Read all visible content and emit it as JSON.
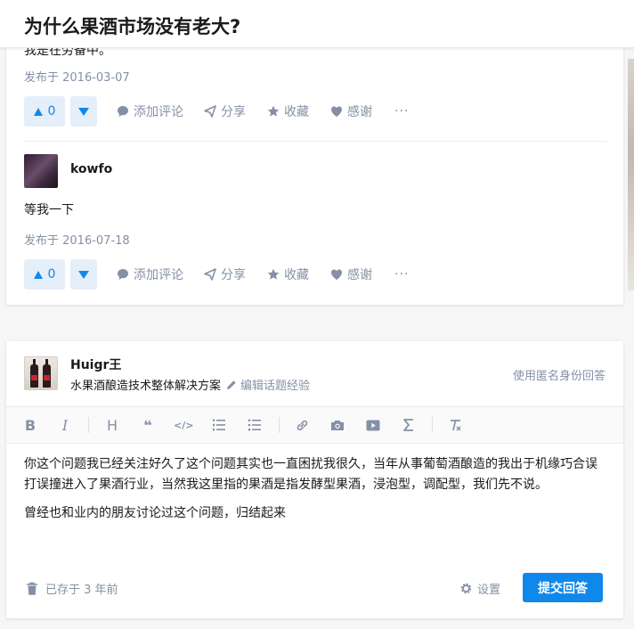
{
  "header": {
    "question_title": "为什么果酒市场没有老大?"
  },
  "answer_first": {
    "clipped_text": "我是在劳备中。",
    "date": "发布于 2016-03-07",
    "upvote_count": "0",
    "actions": {
      "comment": "添加评论",
      "share": "分享",
      "favorite": "收藏",
      "thanks": "感谢",
      "more": "···"
    }
  },
  "answer_second": {
    "author": "kowfo",
    "content": "等我一下",
    "date": "发布于 2016-07-18",
    "upvote_count": "0",
    "actions": {
      "comment": "添加评论",
      "share": "分享",
      "favorite": "收藏",
      "thanks": "感谢",
      "more": "···"
    }
  },
  "composer": {
    "author": "Huigr王",
    "headline": "水果酒酿造技术整体解决方案",
    "edit_topic_experience": "编辑话题经验",
    "anonymous_link": "使用匿名身份回答",
    "toolbar": {
      "bold": "B",
      "italic": "I",
      "heading": "H",
      "quote": "❝",
      "code": "</>"
    },
    "paragraphs": [
      "你这个问题我已经关注好久了这个问题其实也一直困扰我很久，当年从事葡萄酒酿造的我出于机缘巧合误打误撞进入了果酒行业，当然我这里指的果酒是指发酵型果酒，浸泡型，调配型，我们先不说。",
      "曾经也和业内的朋友讨论过这个问题，归结起来"
    ],
    "draft_status": "已存于 3 年前",
    "settings_label": "设置",
    "submit_label": "提交回答"
  },
  "colors": {
    "accent": "#0f88eb",
    "muted": "#8590a6",
    "vote_bg": "#e5effa"
  }
}
